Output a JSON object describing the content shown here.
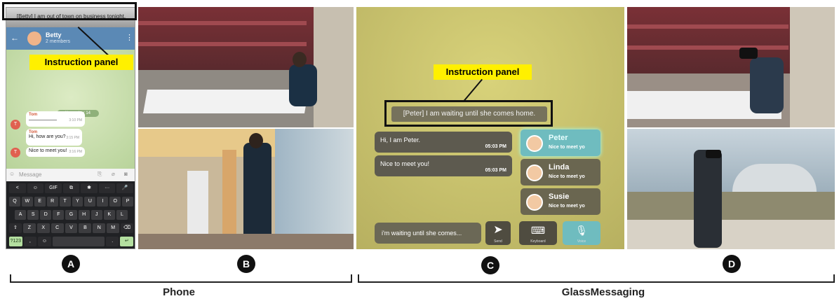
{
  "phone": {
    "instruction_text": "[Betty] I am out of town on business tonight.",
    "instruction_label": "Instruction panel",
    "chat_name": "Betty",
    "chat_members": "2 members",
    "date_chip": "November 14",
    "messages": [
      {
        "from": "Tom",
        "text": "",
        "time": "3:10 PM"
      },
      {
        "from": "Tom",
        "text": "Hi, how are you?",
        "time": "3:15 PM"
      },
      {
        "from": "",
        "text": "Nice to meet you!",
        "time": "3:16 PM"
      }
    ],
    "avatar_letter": "T",
    "message_placeholder": "Message",
    "keyboard": {
      "toolbar": [
        "<",
        "☺",
        "GIF",
        "⧉",
        "✱",
        "···",
        "🎤"
      ],
      "row1": [
        "Q",
        "W",
        "E",
        "R",
        "T",
        "Y",
        "U",
        "I",
        "O",
        "P"
      ],
      "row2": [
        "A",
        "S",
        "D",
        "F",
        "G",
        "H",
        "J",
        "K",
        "L"
      ],
      "row3": [
        "⇧",
        "Z",
        "X",
        "C",
        "V",
        "B",
        "N",
        "M",
        "⌫"
      ],
      "row4": [
        "?123",
        ",",
        "☺",
        "",
        ".",
        "↵"
      ]
    }
  },
  "glass": {
    "instruction_label": "Instruction panel",
    "instruction_text": "[Peter] I am waiting until she comes home.",
    "bubbles": [
      {
        "text": "Hi, I am Peter.",
        "time": "05:03 PM"
      },
      {
        "text": "Nice to meet you!",
        "time": "05:03 PM"
      }
    ],
    "contacts": [
      {
        "name": "Peter",
        "preview": "Nice to meet yo"
      },
      {
        "name": "Linda",
        "preview": "Nice to meet yo"
      },
      {
        "name": "Susie",
        "preview": "Nice to meet yo"
      }
    ],
    "input_text": "i'm waiting until she comes...",
    "send_label": "Send",
    "keyboard_label": "Keyboard",
    "voice_label": "Voice"
  },
  "labels": {
    "a": "A",
    "b": "B",
    "c": "C",
    "d": "D",
    "phone": "Phone",
    "glass": "GlassMessaging"
  }
}
